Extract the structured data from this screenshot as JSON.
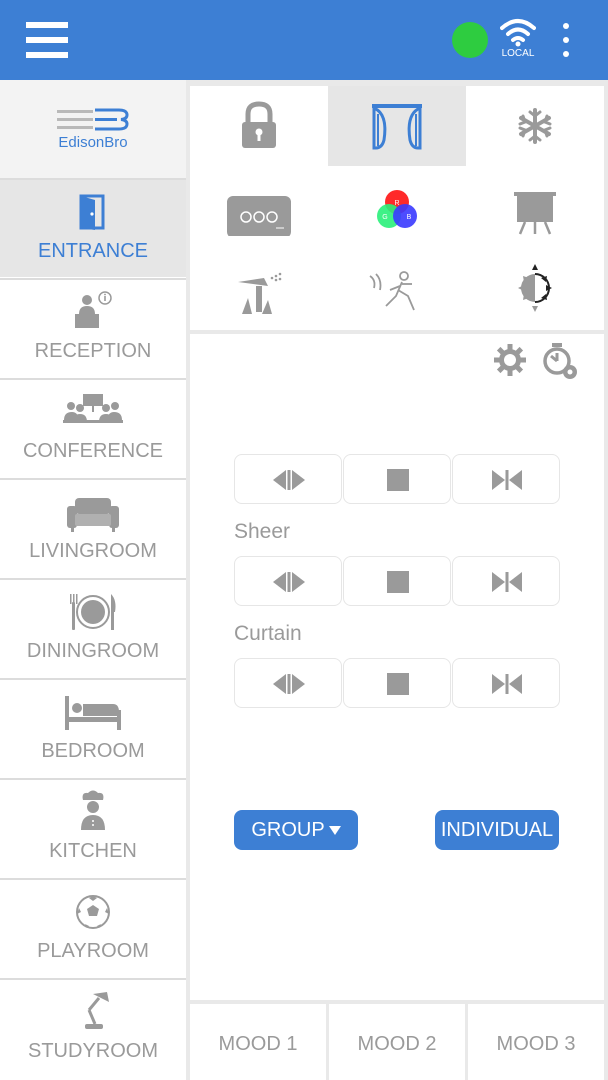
{
  "header": {
    "wifi_label": "LOCAL",
    "status_color": "#2ecc40",
    "accent_color": "#3d7fd4"
  },
  "sidebar": {
    "logo_text": "EdisonBro",
    "items": [
      {
        "label": "ENTRANCE",
        "icon": "door-icon",
        "active": true
      },
      {
        "label": "RECEPTION",
        "icon": "reception-icon",
        "active": false
      },
      {
        "label": "CONFERENCE",
        "icon": "conference-icon",
        "active": false
      },
      {
        "label": "LIVINGROOM",
        "icon": "sofa-icon",
        "active": false
      },
      {
        "label": "DININGROOM",
        "icon": "dining-icon",
        "active": false
      },
      {
        "label": "BEDROOM",
        "icon": "bed-icon",
        "active": false
      },
      {
        "label": "KITCHEN",
        "icon": "chef-icon",
        "active": false
      },
      {
        "label": "PLAYROOM",
        "icon": "soccer-ball-icon",
        "active": false
      },
      {
        "label": "STUDYROOM",
        "icon": "desk-lamp-icon",
        "active": false
      }
    ]
  },
  "devices": [
    {
      "icon": "lock-icon",
      "active": false
    },
    {
      "icon": "curtain-icon",
      "active": true
    },
    {
      "icon": "snowflake-icon",
      "active": false
    },
    {
      "icon": "switch-panel-icon",
      "active": false
    },
    {
      "icon": "rgb-light-icon",
      "active": false,
      "letters": [
        "R",
        "G",
        "B"
      ]
    },
    {
      "icon": "projector-screen-icon",
      "active": false
    },
    {
      "icon": "sprinkler-icon",
      "active": false
    },
    {
      "icon": "motion-sensor-icon",
      "active": false
    },
    {
      "icon": "dimmer-icon",
      "active": false
    }
  ],
  "controls": {
    "rows": [
      {
        "label": ""
      },
      {
        "label": "Sheer"
      },
      {
        "label": "Curtain"
      }
    ],
    "group_label": "GROUP",
    "individual_label": "INDIVIDUAL"
  },
  "moods": [
    "MOOD 1",
    "MOOD 2",
    "MOOD 3"
  ]
}
